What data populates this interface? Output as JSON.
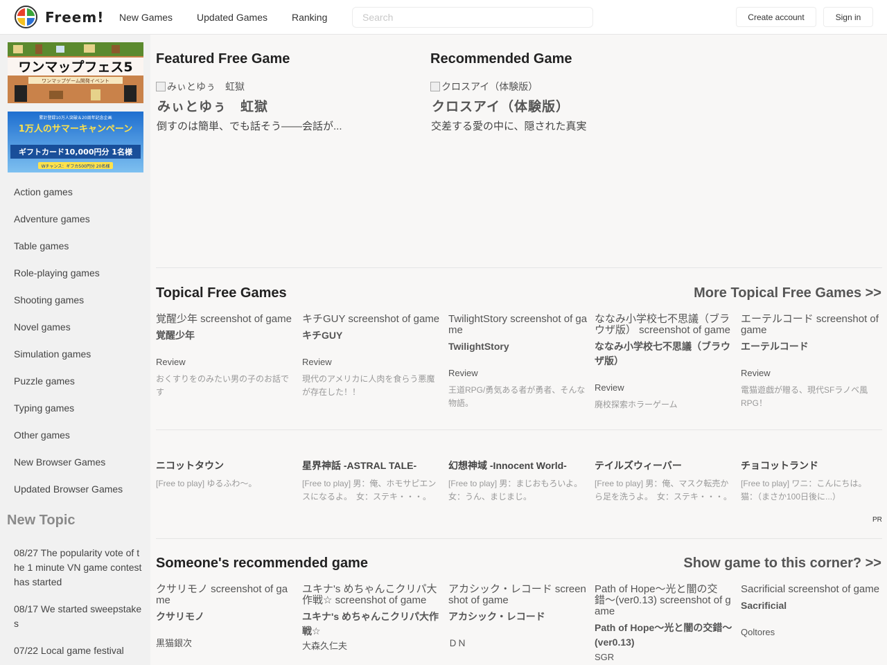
{
  "header": {
    "brand": "Freem!",
    "nav": [
      "New Games",
      "Updated Games",
      "Ranking"
    ],
    "search_placeholder": "Search",
    "create_account": "Create account",
    "sign_in": "Sign in"
  },
  "sidebar": {
    "banner1_title": "ワンマップフェス5",
    "banner1_sub": "ワンマップゲーム開発イベント",
    "banner2_top": "累計登録10万人突破＆20周年記念企画",
    "banner2_title": "1万人のサマーキャンペーン",
    "banner2_line": "ギフトカード10,000円分 1名様",
    "banner2_bottom": "Wチャンス：ギフカ500円分 20名様",
    "genres": [
      "Action games",
      "Adventure games",
      "Table games",
      "Role-playing games",
      "Shooting games",
      "Novel games",
      "Simulation games",
      "Puzzle games",
      "Typing games",
      "Other games",
      "New Browser Games",
      "Updated Browser Games"
    ],
    "new_topic_title": "New Topic",
    "topics": [
      "08/27 The popularity vote of the 1 minute VN game contest has started",
      "08/17 We started sweepstakes",
      "07/22 Local game festival"
    ]
  },
  "featured": {
    "title": "Featured Free Game",
    "alt": "みぃとゆぅ　虹獄",
    "name": "みぃとゆぅ　虹獄",
    "desc": "倒すのは簡単、でも話そう——会話が..."
  },
  "recommended": {
    "title": "Recommended Game",
    "alt": "クロスアイ（体験版）",
    "name": "クロスアイ（体験版）",
    "desc": "交差する愛の中に、隠された真実"
  },
  "topical": {
    "title": "Topical Free Games",
    "more": "More Topical Free Games >>",
    "cards": [
      {
        "alt": "覚醒少年 screenshot of game",
        "name": "覚醒少年",
        "label": "Review",
        "desc": "おくすりをのみたい男の子のお話です"
      },
      {
        "alt": "キチGUY screenshot of game",
        "name": "キチGUY",
        "label": "Review",
        "desc": "現代のアメリカに人肉を食らう悪魔が存在した！！"
      },
      {
        "alt": "TwilightStory screenshot of game",
        "name": "TwilightStory",
        "label": "Review",
        "desc": "王道RPG/勇気ある者が勇者、そんな物語。"
      },
      {
        "alt": "ななみ小学校七不思議（ブラウザ版） screenshot of game",
        "name": "ななみ小学校七不思議（ブラウザ版）",
        "label": "Review",
        "desc": "廃校探索ホラーゲーム"
      },
      {
        "alt": "エーテルコード screenshot of game",
        "name": "エーテルコード",
        "label": "Review",
        "desc": "電猫遊戯が贈る、現代SFラノベ風RPG！"
      }
    ]
  },
  "pr": {
    "badge": "PR",
    "items": [
      {
        "name": "ニコットタウン",
        "desc": "[Free to play] ゆるふわ〜。"
      },
      {
        "name": "星界神話 -ASTRAL TALE-",
        "desc": "[Free to play] 男：俺、ホモサピエンスになるよ。　女：ステキ・・・。"
      },
      {
        "name": "幻想神域 -Innocent World-",
        "desc": "[Free to play] 男：まじおもろいよ。　女：うん、まじまじ。"
      },
      {
        "name": "テイルズウィーバー",
        "desc": "[Free to play] 男：俺、マスク転売から足を洗うよ。　女：ステキ・・・。"
      },
      {
        "name": "チョコットランド",
        "desc": "[Free to play] ワニ：こんにちは。　猫：（まさか100日後に...）"
      }
    ]
  },
  "someone": {
    "title": "Someone's recommended game",
    "more": "Show game to this corner? >>",
    "cards": [
      {
        "alt": "クサリモノ screenshot of game",
        "name": "クサリモノ",
        "author": "黒猫銀次"
      },
      {
        "alt": "ユキナ's めちゃんこクリパ大作戦☆ screenshot of game",
        "name": "ユキナ's めちゃんこクリパ大作戦☆",
        "author": "大森久仁夫"
      },
      {
        "alt": "アカシック・レコード screenshot of game",
        "name": "アカシック・レコード",
        "author": "ＤＮ"
      },
      {
        "alt": "Path of Hope〜光と闇の交錯〜(ver0.13) screenshot of game",
        "name": "Path of Hope〜光と闇の交錯〜(ver0.13)",
        "author": "SGR"
      },
      {
        "alt": "Sacrificial screenshot of game",
        "name": "Sacrificial",
        "author": "Qoltores"
      }
    ]
  }
}
